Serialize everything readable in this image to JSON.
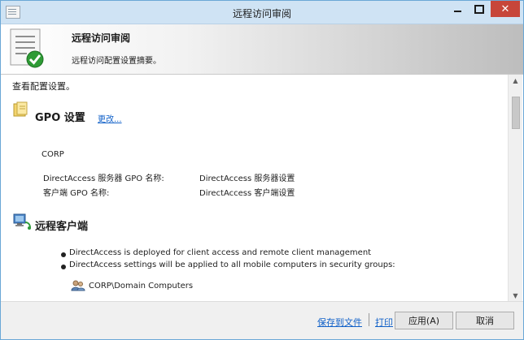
{
  "window": {
    "title": "远程访问审阅",
    "close_glyph": "✕"
  },
  "header": {
    "title": "远程访问审阅",
    "subtitle": "远程访问配置设置摘要。"
  },
  "content": {
    "view_label": "查看配置设置。",
    "gpo_section": {
      "heading": "GPO 设置",
      "change_link": "更改...",
      "domain": "CORP",
      "rows": [
        {
          "label": "DirectAccess 服务器 GPO 名称:",
          "value": "DirectAccess 服务器设置"
        },
        {
          "label": "客户端 GPO 名称:",
          "value": "DirectAccess 客户端设置"
        }
      ]
    },
    "remote_client_section": {
      "heading": "远程客户端",
      "bullets": [
        "DirectAccess is deployed for client access and remote client management",
        "DirectAccess settings will be applied to all mobile computers in security groups:"
      ],
      "security_group": "CORP\\Domain Computers"
    }
  },
  "footer": {
    "save_link": "保存到文件",
    "print_link": "打印",
    "apply_button": "应用(A)",
    "cancel_button": "取消"
  },
  "icons": {
    "app": "app-icon",
    "wizard": "checklist-check-icon",
    "gpo": "gpo-folder-icon",
    "remote": "remote-computer-icon",
    "group": "user-group-icon"
  },
  "colors": {
    "titlebar": "#cfe3f4",
    "close_button": "#c7463a",
    "link": "#1060c8",
    "check_green": "#2e9b35"
  }
}
